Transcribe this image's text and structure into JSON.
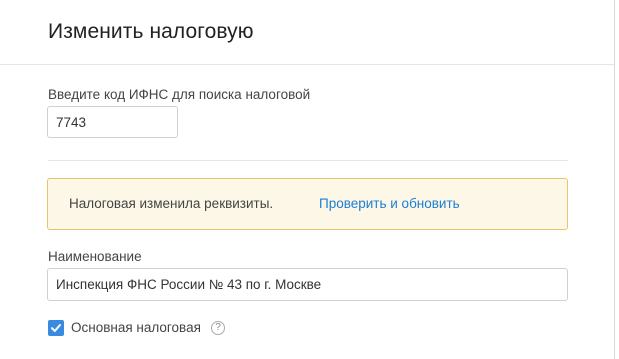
{
  "header": {
    "title": "Изменить налоговую"
  },
  "ifns_search": {
    "label": "Введите код ИФНС для поиска налоговой",
    "value": "7743"
  },
  "alert": {
    "message": "Налоговая изменила реквизиты.",
    "action_label": "Проверить и обновить"
  },
  "name_field": {
    "label": "Наименование",
    "value": "Инспекция ФНС России № 43 по г. Москве"
  },
  "primary_checkbox": {
    "label": "Основная налоговая",
    "checked": true,
    "help_icon": "question-circle-icon",
    "help_glyph": "?"
  },
  "colors": {
    "accent": "#3a8be0",
    "link": "#1a7fd6",
    "alert_background": "#fdf7e7",
    "alert_border": "#e9c56a"
  }
}
